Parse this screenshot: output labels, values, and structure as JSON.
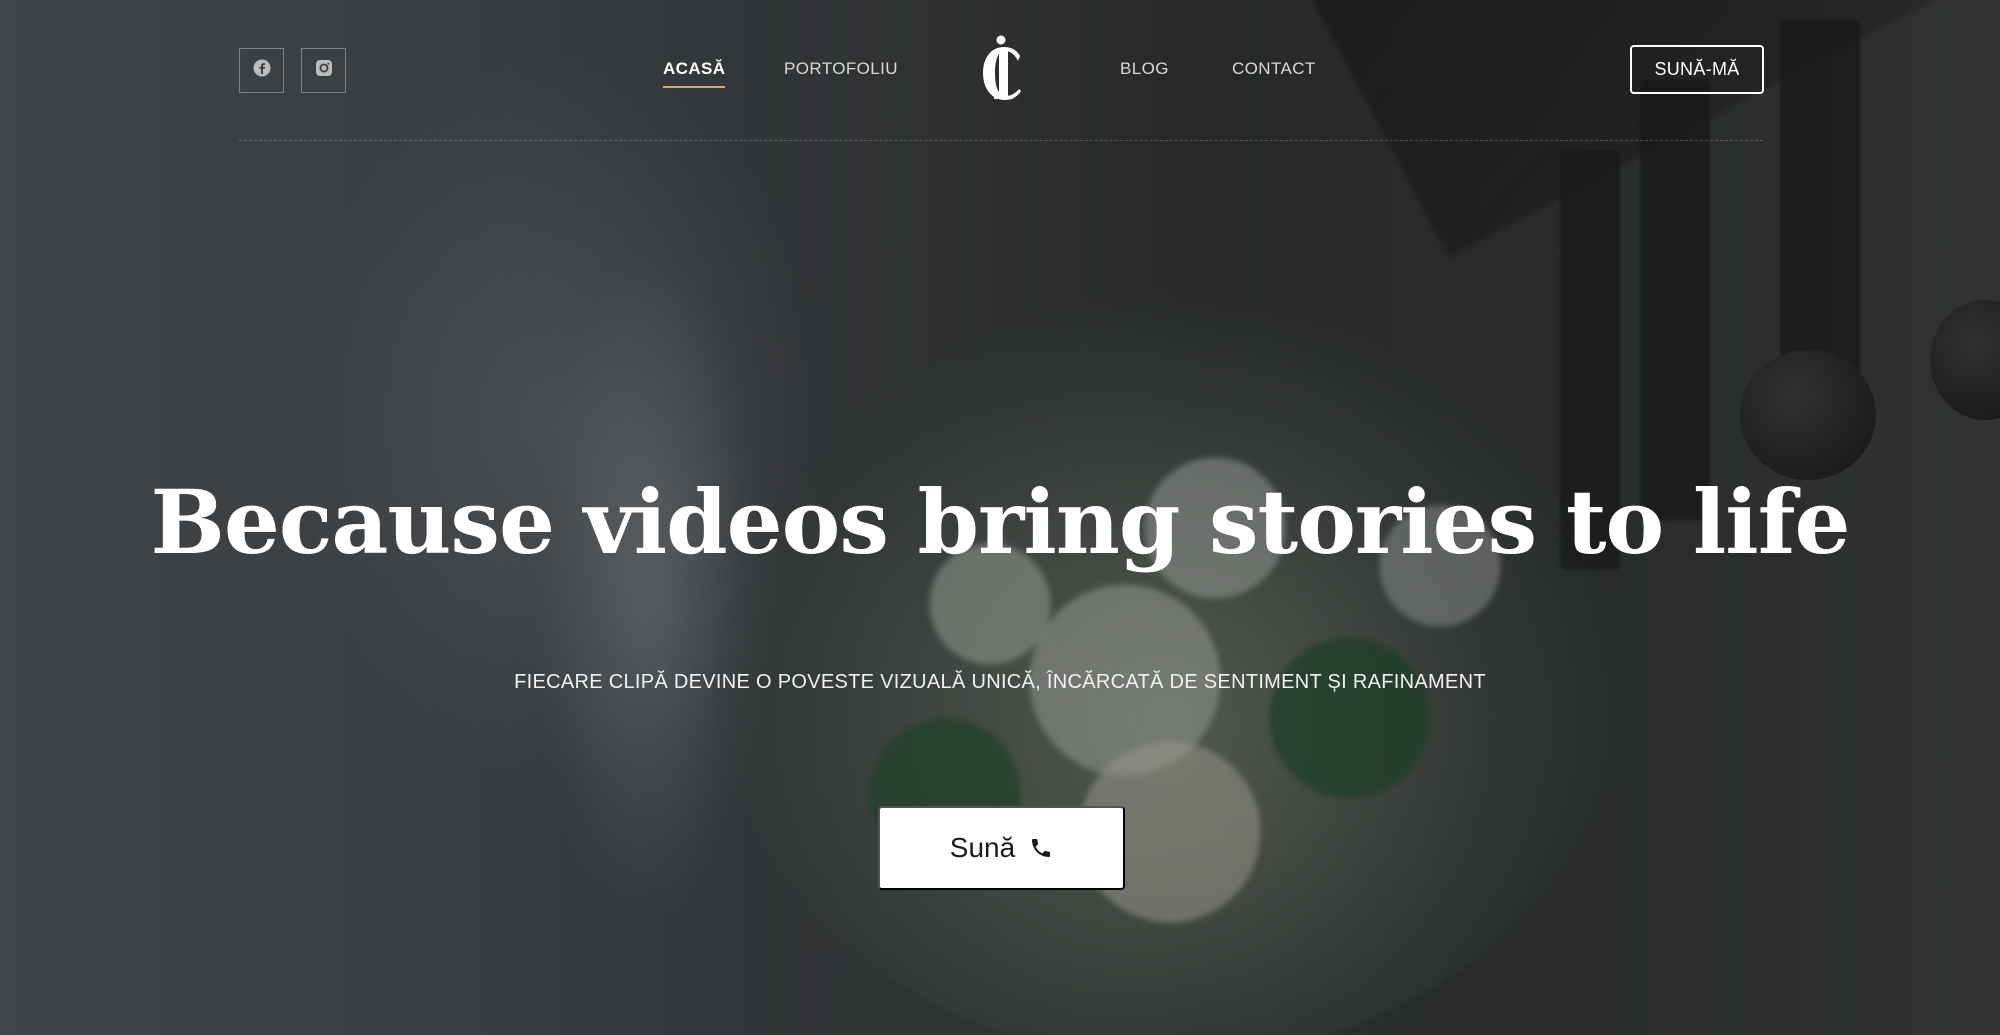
{
  "header": {
    "social": [
      {
        "icon": "facebook-icon"
      },
      {
        "icon": "instagram-icon"
      }
    ],
    "nav_left": [
      {
        "label": "ACASĂ",
        "active": true
      },
      {
        "label": "PORTOFOLIU",
        "active": false
      }
    ],
    "nav_right": [
      {
        "label": "BLOG",
        "active": false
      },
      {
        "label": "CONTACT",
        "active": false
      }
    ],
    "logo_icon": "ci-monogram-logo",
    "cta_label": "SUNĂ-MĂ"
  },
  "hero": {
    "headline": "Because videos bring stories to life",
    "subheadline": "FIECARE CLIPĂ DEVINE O POVESTE VIZUALĂ UNICĂ, ÎNCĂRCATĂ DE SENTIMENT ȘI RAFINAMENT",
    "cta_label": "Sună",
    "cta_icon": "phone-icon"
  },
  "colors": {
    "accent": "#d9a56a",
    "text": "#ffffff",
    "button_bg": "#ffffff",
    "button_text": "#1b1b1b"
  }
}
